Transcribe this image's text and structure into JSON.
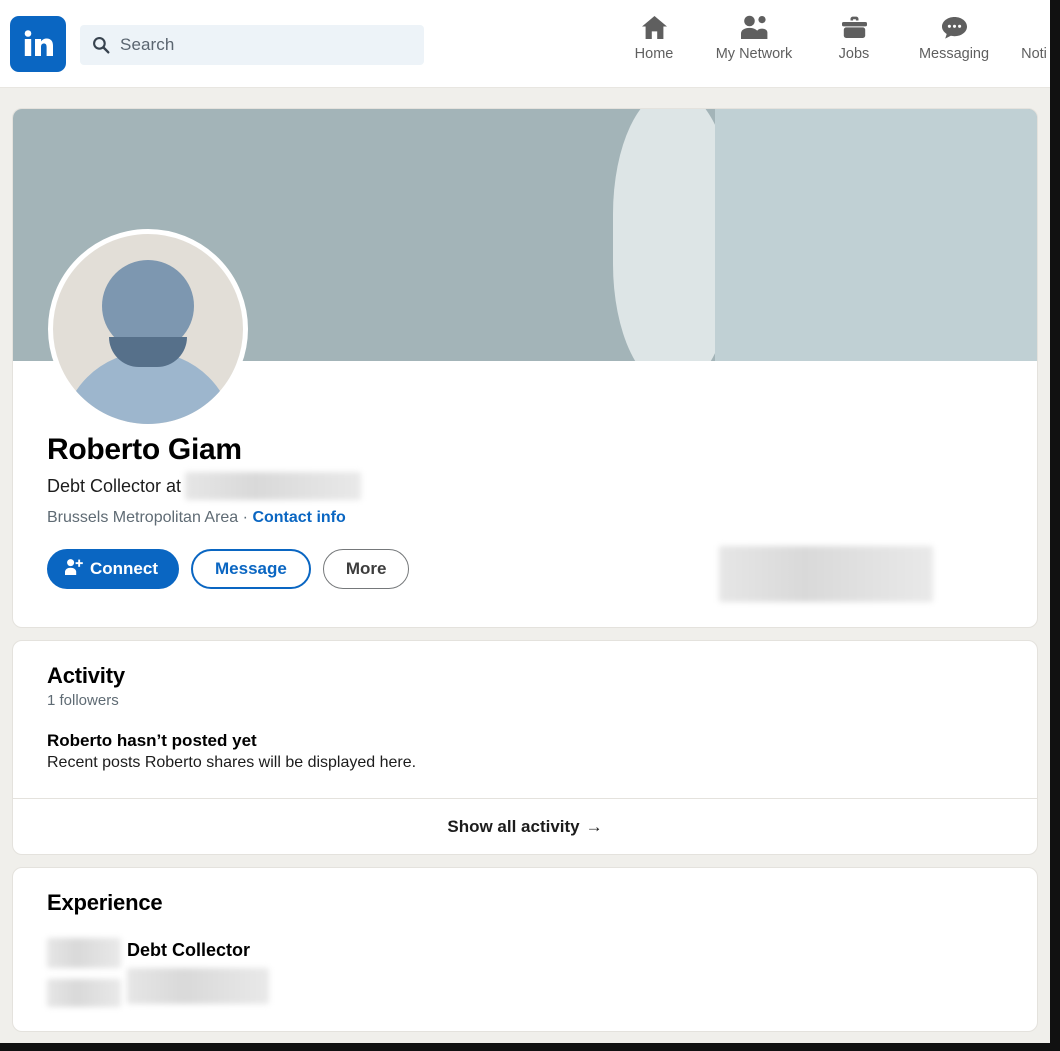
{
  "header": {
    "logo": "linkedin-logo",
    "search": {
      "placeholder": "Search",
      "value": ""
    },
    "nav": [
      {
        "icon": "home-icon",
        "label": "Home"
      },
      {
        "icon": "my-network-icon",
        "label": "My Network"
      },
      {
        "icon": "jobs-icon",
        "label": "Jobs"
      },
      {
        "icon": "messaging-icon",
        "label": "Messaging"
      },
      {
        "icon": "notifications-icon",
        "label": "Noti"
      }
    ]
  },
  "profile": {
    "name": "Roberto Giam",
    "headline_prefix": "Debt Collector at",
    "headline_company": "",
    "location": "Brussels Metropolitan Area",
    "separator": "·",
    "contact_info_label": "Contact info",
    "buttons": {
      "connect": "Connect",
      "message": "Message",
      "more": "More"
    }
  },
  "activity": {
    "title": "Activity",
    "followers": "1 followers",
    "empty_title": "Roberto hasn’t posted yet",
    "empty_subtitle": "Recent posts Roberto shares will be displayed here.",
    "show_all": "Show all activity",
    "show_all_arrow": "→"
  },
  "experience": {
    "title": "Experience",
    "items": [
      {
        "role": "Debt Collector",
        "company": ""
      }
    ]
  },
  "colors": {
    "brand_blue": "#0a66c2",
    "page_bg": "#f0efeb",
    "card_bg": "#ffffff",
    "banner_left": "#a3b4b8",
    "banner_mid": "#dde5e6",
    "banner_right": "#c0d0d4",
    "text_muted": "#5f6b74"
  }
}
